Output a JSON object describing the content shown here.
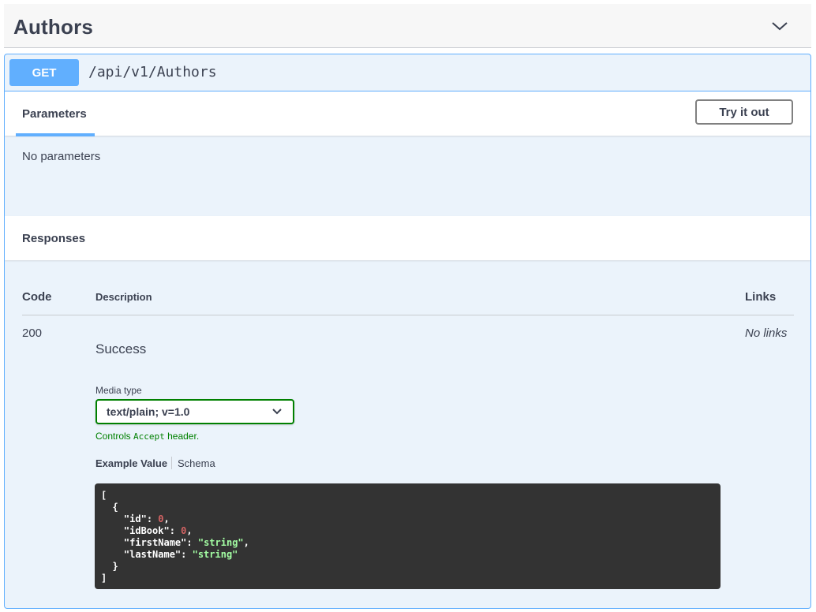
{
  "tag": {
    "title": "Authors"
  },
  "operation": {
    "method": "GET",
    "path": "/api/v1/Authors",
    "method_color": "#61affe"
  },
  "parameters": {
    "tab_label": "Parameters",
    "try_label": "Try it out",
    "empty_text": "No parameters"
  },
  "responses": {
    "title": "Responses",
    "columns": {
      "code": "Code",
      "description": "Description",
      "links": "Links"
    },
    "rows": [
      {
        "code": "200",
        "description": "Success",
        "links": "No links",
        "media_type_label": "Media type",
        "media_type_value": "text/plain; v=1.0",
        "controls_prefix": "Controls ",
        "controls_code": "Accept",
        "controls_suffix": " header.",
        "example_tab": "Example Value",
        "schema_tab": "Schema",
        "example": {
          "open_bracket": "[",
          "open_brace": "{",
          "fields": [
            {
              "key": "\"id\"",
              "sep": ": ",
              "value": "0",
              "type": "number",
              "trail": ","
            },
            {
              "key": "\"idBook\"",
              "sep": ": ",
              "value": "0",
              "type": "number",
              "trail": ","
            },
            {
              "key": "\"firstName\"",
              "sep": ": ",
              "value": "\"string\"",
              "type": "string",
              "trail": ","
            },
            {
              "key": "\"lastName\"",
              "sep": ": ",
              "value": "\"string\"",
              "type": "string",
              "trail": ""
            }
          ],
          "close_brace": "}",
          "close_bracket": "]"
        }
      }
    ]
  }
}
